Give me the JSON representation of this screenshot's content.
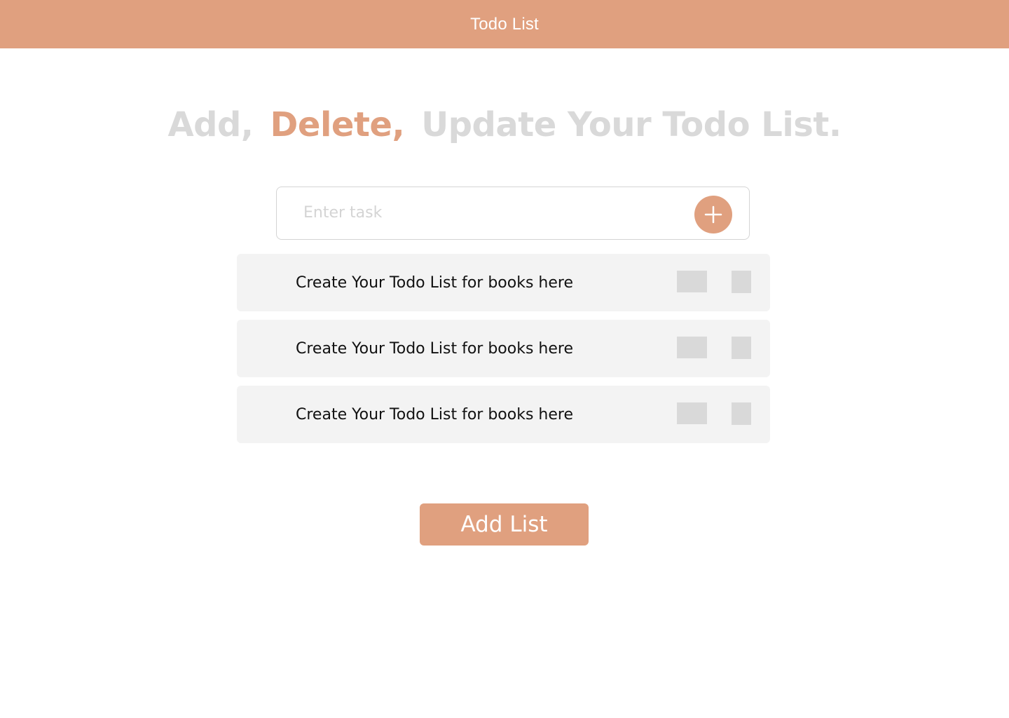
{
  "header": {
    "title": "Todo List"
  },
  "headline": {
    "part1": "Add,",
    "part2": "Delete,",
    "part3": "Update Your Todo List."
  },
  "task_input": {
    "value": "",
    "placeholder": "Enter task",
    "add_icon": "plus-icon"
  },
  "todos": [
    {
      "text": "Create Your Todo List for books here"
    },
    {
      "text": "Create Your Todo List for books here"
    },
    {
      "text": "Create Your Todo List for books here"
    }
  ],
  "add_list_button": {
    "label": "Add List"
  },
  "colors": {
    "accent": "#E0A07F",
    "muted_text": "#D9D9D9",
    "item_background": "#F3F3F3",
    "action_placeholder": "#D9D9D9"
  }
}
